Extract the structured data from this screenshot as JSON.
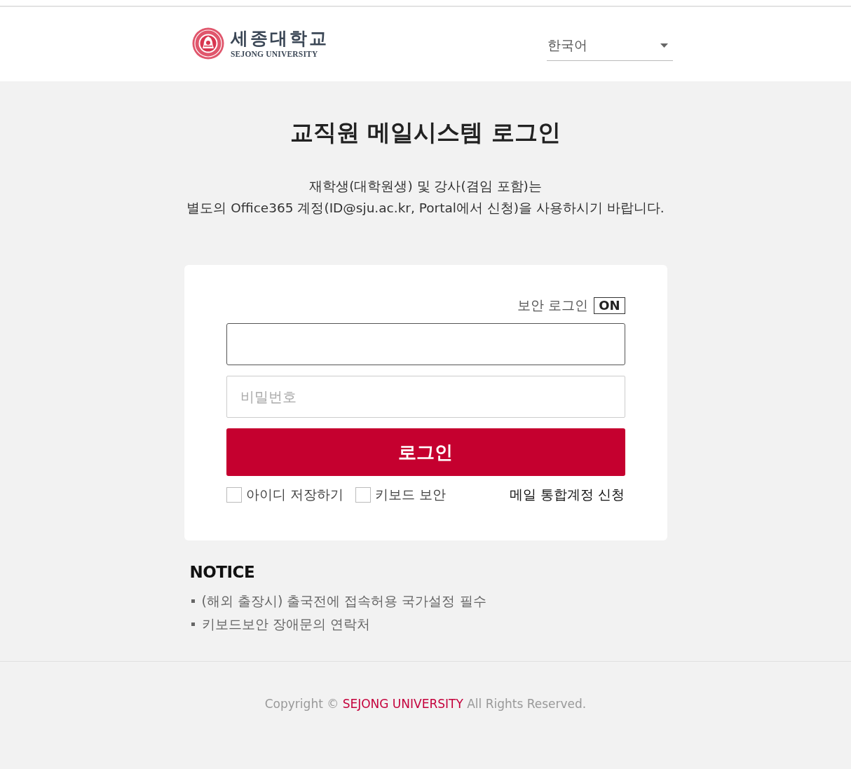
{
  "header": {
    "logo": {
      "name_korean": "세종대학교",
      "name_english": "SEJONG UNIVERSITY"
    },
    "language_select": {
      "value": "한국어"
    }
  },
  "title": "교직원 메일시스템 로그인",
  "description": [
    "재학생(대학원생) 및 강사(겸임 포함)는",
    "별도의 Office365 계정(ID@sju.ac.kr, Portal에서 신청)을 사용하시기 바랍니다."
  ],
  "login_form": {
    "secure_login": {
      "label": "보안 로그인",
      "badge": "ON"
    },
    "id_field": {
      "focused": true
    },
    "password_field": {
      "placeholder": "비밀번호",
      "focused": false
    },
    "login_button": "로그인",
    "options": [
      {
        "label": "아이디 저장하기",
        "checked": false
      },
      {
        "label": "키보드 보안",
        "checked": false
      }
    ],
    "signup_link": "메일 통합계정 신청"
  },
  "notice": {
    "title": "NOTICE",
    "items": [
      "(해외 출장시) 출국전에 접속허용 국가설정 필수",
      "키보드보안 장애문의 연락처"
    ]
  },
  "footer": {
    "copyright_prefix": "Copyright ©",
    "university": "SEJONG UNIVERSITY",
    "suffix": "All Rights Reserved."
  }
}
